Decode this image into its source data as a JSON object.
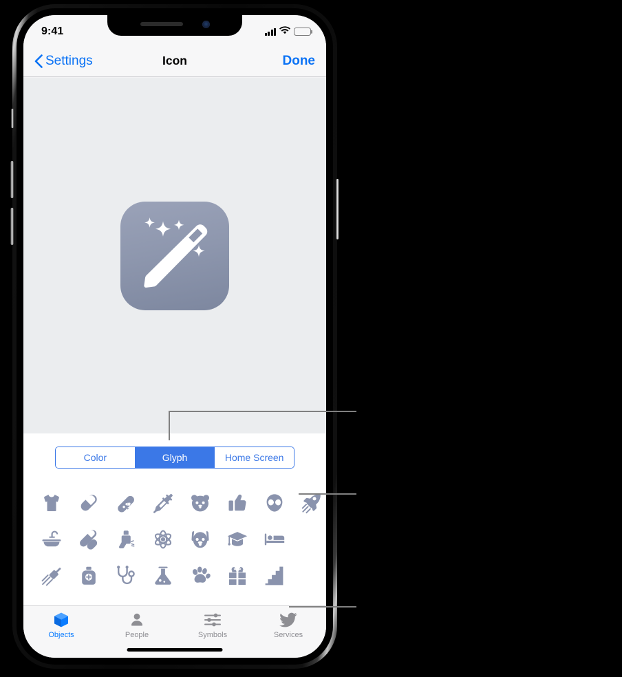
{
  "status_bar": {
    "time": "9:41",
    "cellular_icon": "signal-bars-icon",
    "wifi_icon": "wifi-icon",
    "battery_icon": "battery-icon"
  },
  "nav_bar": {
    "back_label": "Settings",
    "back_icon": "chevron-left-icon",
    "title": "Icon",
    "done_label": "Done"
  },
  "preview": {
    "icon_name": "magic-wand-app-icon",
    "gradient_top": "#9aa2b8",
    "gradient_bottom": "#7d879f",
    "glyph_color": "#ffffff"
  },
  "segmented_control": {
    "accent_color": "#3b78e7",
    "selected": "Glyph",
    "options": [
      {
        "label": "Color",
        "selected": false
      },
      {
        "label": "Glyph",
        "selected": true
      },
      {
        "label": "Home Screen",
        "selected": false
      }
    ]
  },
  "glyph_grid": {
    "glyph_color": "#8a93ad",
    "rows": [
      [
        {
          "name": "tshirt-glyph"
        },
        {
          "name": "pill-capsule-glyph"
        },
        {
          "name": "handheld-game-console-glyph"
        },
        {
          "name": "syringe-glyph"
        },
        {
          "name": "bear-face-glyph"
        },
        {
          "name": "thumbs-up-glyph"
        },
        {
          "name": "alien-head-glyph"
        },
        {
          "name": "rocket-glyph"
        }
      ],
      [
        {
          "name": "bathtub-glyph"
        },
        {
          "name": "bandages-glyph"
        },
        {
          "name": "inhaler-glyph"
        },
        {
          "name": "atom-glyph"
        },
        {
          "name": "dog-face-glyph"
        },
        {
          "name": "graduation-cap-glyph"
        },
        {
          "name": "bed-glyph"
        }
      ],
      [
        {
          "name": "shower-head-glyph"
        },
        {
          "name": "medicine-bottle-glyph"
        },
        {
          "name": "stethoscope-glyph"
        },
        {
          "name": "lab-flask-glyph"
        },
        {
          "name": "paw-print-glyph"
        },
        {
          "name": "gift-box-glyph"
        },
        {
          "name": "stairs-glyph"
        }
      ]
    ]
  },
  "tab_bar": {
    "active_color": "#0a7cff",
    "inactive_color": "#8e8e93",
    "tabs": [
      {
        "label": "Objects",
        "icon": "cube-icon",
        "active": true
      },
      {
        "label": "People",
        "icon": "person-icon",
        "active": false
      },
      {
        "label": "Symbols",
        "icon": "sliders-icon",
        "active": false
      },
      {
        "label": "Services",
        "icon": "bird-icon",
        "active": false
      }
    ]
  },
  "callouts": {
    "line_color": "#808080",
    "items": [
      {
        "name": "callout-segmented-control"
      },
      {
        "name": "callout-glyph-grid"
      },
      {
        "name": "callout-tab-bar"
      }
    ]
  }
}
